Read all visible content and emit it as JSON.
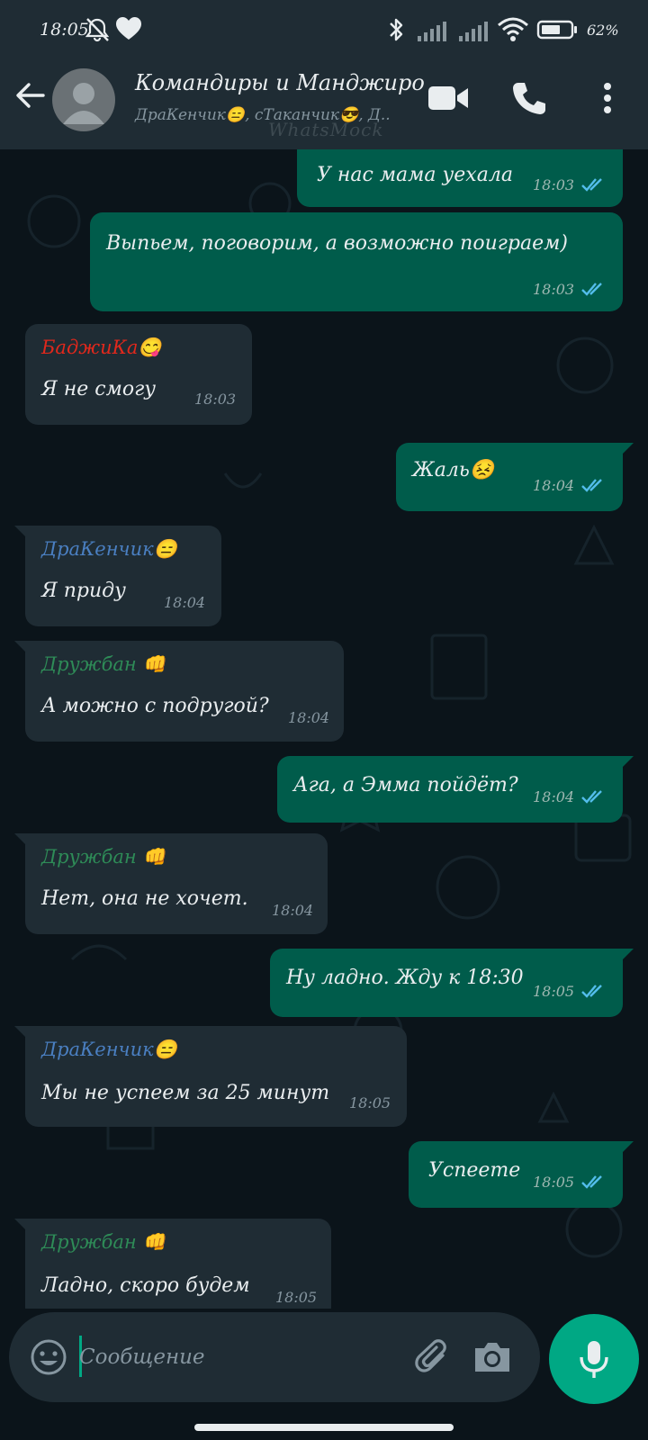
{
  "status_bar": {
    "time": "18:05",
    "battery_percent": "62%",
    "icons": [
      "bell-off-icon",
      "heart-icon",
      "bluetooth-icon",
      "signal-icon",
      "signal-icon",
      "wifi-icon",
      "battery-icon"
    ]
  },
  "header": {
    "title": "Командиры и Манджиро",
    "members": "ДраКенчик😑, сТаканчик😎, Д..",
    "watermark": "WhatsMock"
  },
  "messages": [
    {
      "dir": "out",
      "text": "У нас мама уехала",
      "time": "18:03"
    },
    {
      "dir": "out",
      "text": "Выпьем, поговорим, а возможно поиграем)",
      "time": "18:03"
    },
    {
      "dir": "in",
      "sender": "БаджиКа😋",
      "sender_color": "#e0281c",
      "text": "Я не смогу",
      "time": "18:03"
    },
    {
      "dir": "out",
      "text": "Жаль😣",
      "time": "18:04"
    },
    {
      "dir": "in",
      "sender": "ДраКенчик😑",
      "sender_color": "#4a7fc1",
      "text": "Я приду",
      "time": "18:04"
    },
    {
      "dir": "in",
      "sender": "Дружбан 👊",
      "sender_color": "#2e8b57",
      "text": "А можно с подругой?",
      "time": "18:04"
    },
    {
      "dir": "out",
      "text": "Ага, а Эмма пойдёт?",
      "time": "18:04"
    },
    {
      "dir": "in",
      "sender": "Дружбан 👊",
      "sender_color": "#2e8b57",
      "text": "Нет, она не хочет.",
      "time": "18:04"
    },
    {
      "dir": "out",
      "text": "Ну ладно. Жду к 18:30",
      "time": "18:05"
    },
    {
      "dir": "in",
      "sender": "ДраКенчик😑",
      "sender_color": "#4a7fc1",
      "text": "Мы не успеем за 25 минут",
      "time": "18:05"
    },
    {
      "dir": "out",
      "text": "Успеете",
      "time": "18:05"
    },
    {
      "dir": "in",
      "sender": "Дружбан 👊",
      "sender_color": "#2e8b57",
      "text": "Ладно, скоро будем",
      "time": "18:05"
    }
  ],
  "composer": {
    "placeholder": "Сообщение",
    "value": ""
  },
  "colors": {
    "accent": "#00a884",
    "outgoing_bubble": "#005c4b",
    "incoming_bubble": "#1f2c34",
    "read_ticks": "#53bdeb",
    "background": "#0b141a"
  }
}
